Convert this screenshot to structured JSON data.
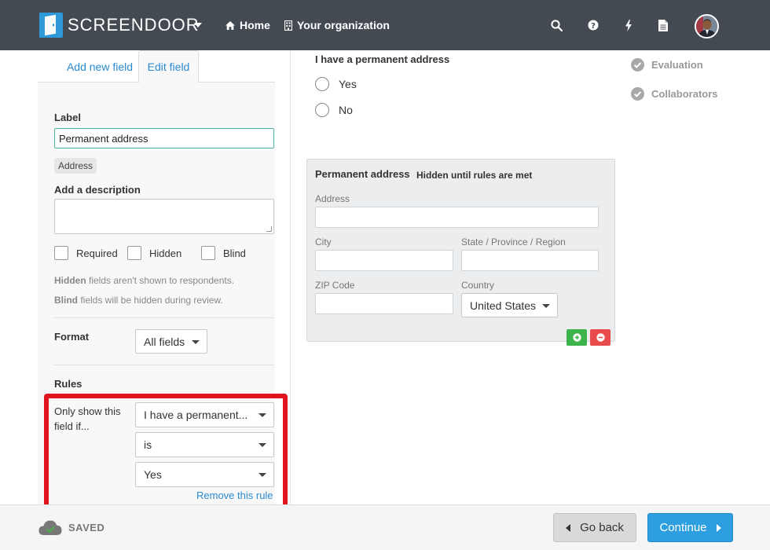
{
  "colors": {
    "navbar": "#444a52",
    "accent": "#2e9ad7",
    "link": "#2a8bd1",
    "highlight": "#e0141e",
    "success": "#3cb44b",
    "danger": "#e84b4b"
  },
  "navbar": {
    "brand": "SCREENDOOR",
    "links": [
      {
        "label": "Home",
        "icon": "home-icon"
      },
      {
        "label": "Your organization",
        "icon": "building-icon"
      }
    ],
    "icons": [
      "search-icon",
      "help-icon",
      "bolt-icon",
      "document-icon"
    ]
  },
  "sidebar": {
    "tabs": [
      {
        "label": "Add new field",
        "active": false
      },
      {
        "label": "Edit field",
        "active": true
      }
    ],
    "label_heading": "Label",
    "label_value": "Permanent address",
    "field_type_tag": "Address",
    "description_heading": "Add a description",
    "checkboxes": [
      "Required",
      "Hidden",
      "Blind"
    ],
    "help_hidden_bold": "Hidden",
    "help_hidden_rest": " fields aren't shown to respondents.",
    "help_blind_bold": "Blind",
    "help_blind_rest": " fields will be hidden during review.",
    "format_heading": "Format",
    "format_value": "All fields",
    "rules_heading": "Rules",
    "rule": {
      "prefix_text": "Only show this field if...",
      "condition_field": "I have a permanent...",
      "operator": "is",
      "value": "Yes",
      "remove_link": "Remove this rule"
    }
  },
  "main": {
    "question_label": "I have a permanent address",
    "options": [
      "Yes",
      "No"
    ],
    "address_card": {
      "title": "Permanent address",
      "subtitle": "Hidden until rules are met",
      "fields": {
        "address": "Address",
        "city": "City",
        "state": "State / Province / Region",
        "zip": "ZIP Code",
        "country": "Country"
      },
      "country_value": "United States"
    }
  },
  "right_steps": [
    "Evaluation",
    "Collaborators"
  ],
  "footer": {
    "saved_label": "SAVED",
    "back_label": "Go back",
    "continue_label": "Continue"
  }
}
